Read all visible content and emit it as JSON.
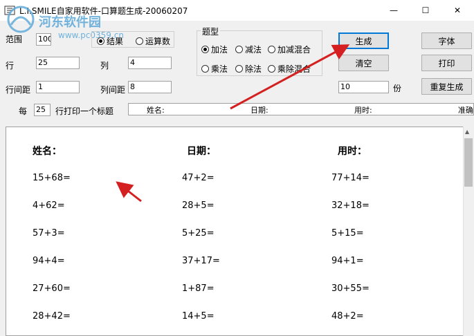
{
  "window": {
    "title": "L.I.SMILE自家用软件-口算题生成-20060207",
    "minimize_glyph": "—",
    "maximize_glyph": "☐",
    "close_glyph": "✕"
  },
  "watermark": {
    "text": "河东软件园",
    "url": "www.pc0359.cn"
  },
  "form": {
    "range_label": "范围",
    "range_value": "100",
    "display_mode": {
      "options": [
        "结果",
        "运算数"
      ],
      "selected": "结果"
    },
    "rows_label": "行",
    "rows_value": "25",
    "cols_label": "列",
    "cols_value": "4",
    "row_spacing_label": "行间距",
    "row_spacing_value": "1",
    "col_spacing_label": "列间距",
    "col_spacing_value": "8",
    "question_type": {
      "title": "题型",
      "options": [
        "加法",
        "减法",
        "加减混合",
        "乘法",
        "除法",
        "乘除混合"
      ],
      "selected": "加法"
    },
    "every_label": "每",
    "every_value": "25",
    "print_title_label": "行打印一个标题",
    "header_fields": [
      "姓名:",
      "日期:",
      "用时:",
      "准确"
    ],
    "copies_value": "10",
    "copies_unit": "份"
  },
  "buttons": {
    "generate": "生成",
    "clear": "清空",
    "font": "字体",
    "print": "打印",
    "regenerate": "重复生成"
  },
  "sheet": {
    "headers": [
      "姓名：",
      "日期：",
      "用时："
    ],
    "rows": [
      [
        "15+68=",
        "47+2=",
        "77+14="
      ],
      [
        "4+62=",
        "28+5=",
        "32+18="
      ],
      [
        "57+3=",
        "5+25=",
        "5+15="
      ],
      [
        "94+4=",
        "37+17=",
        "94+1="
      ],
      [
        "27+60=",
        "1+87=",
        "30+55="
      ],
      [
        "28+42=",
        "14+5=",
        "48+2="
      ]
    ]
  },
  "colors": {
    "accent": "#0078d7",
    "arrow": "#d42020"
  }
}
